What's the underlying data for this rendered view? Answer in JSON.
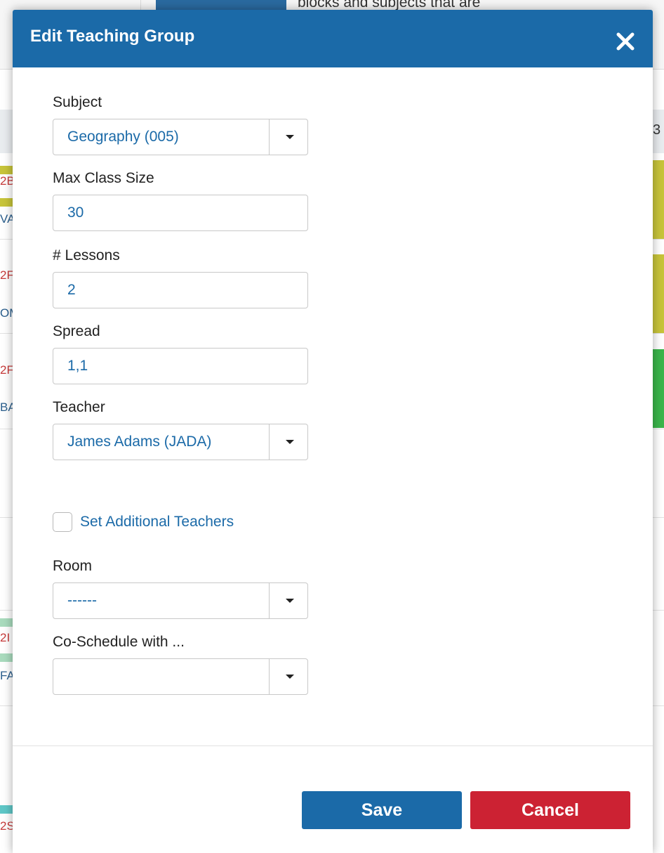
{
  "background": {
    "header_snippet": "blocks and subjects that are",
    "edge_number": "3",
    "left_codes": [
      {
        "text": "2B",
        "color": "red"
      },
      {
        "text": "VA",
        "color": "blue"
      },
      {
        "text": "2F",
        "color": "red"
      },
      {
        "text": "OM",
        "color": "blue"
      },
      {
        "text": "2F",
        "color": "red"
      },
      {
        "text": "BA",
        "color": "blue"
      },
      {
        "text": "2I",
        "color": "red"
      },
      {
        "text": "FA",
        "color": "blue"
      },
      {
        "text": "2S",
        "color": "red"
      }
    ]
  },
  "modal": {
    "title": "Edit Teaching Group",
    "close_icon": "close-icon",
    "fields": {
      "subject": {
        "label": "Subject",
        "value": "Geography (005)"
      },
      "max_class_size": {
        "label": "Max Class Size",
        "value": "30"
      },
      "lessons": {
        "label": "# Lessons",
        "value": "2"
      },
      "spread": {
        "label": "Spread",
        "value": "1,1"
      },
      "teacher": {
        "label": "Teacher",
        "value": "James Adams (JADA)"
      },
      "additional_teachers": {
        "label": "Set Additional Teachers",
        "checked": false
      },
      "room": {
        "label": "Room",
        "value": "------"
      },
      "co_schedule": {
        "label": "Co-Schedule with ...",
        "value": ""
      }
    },
    "buttons": {
      "save": "Save",
      "cancel": "Cancel"
    }
  },
  "colors": {
    "primary": "#1b6aa8",
    "danger": "#cc2233",
    "text": "#222222",
    "border": "#c8c8c8"
  }
}
